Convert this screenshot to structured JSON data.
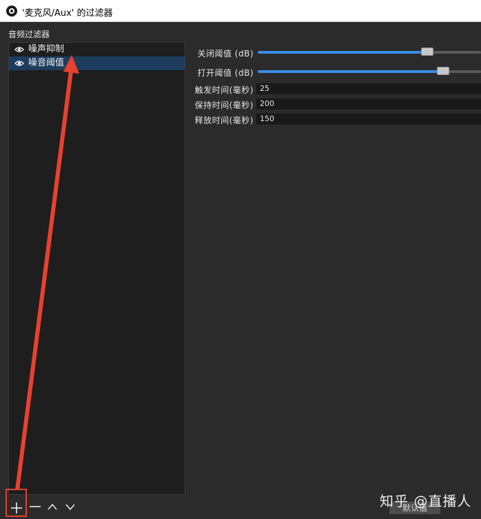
{
  "window": {
    "title": "'麦克风/Aux' 的过滤器",
    "app_icon": "obs-logo-icon"
  },
  "filters": {
    "section_label": "音频过滤器",
    "items": [
      {
        "label": "噪声抑制",
        "icon": "eye-icon",
        "selected": false
      },
      {
        "label": "噪音阈值",
        "icon": "eye-icon",
        "selected": true
      }
    ]
  },
  "properties": {
    "close_threshold": {
      "label": "关闭阈值 (dB)",
      "fill_fraction": 0.76
    },
    "open_threshold": {
      "label": "打开阈值 (dB)",
      "fill_fraction": 0.83
    },
    "attack_time": {
      "label": "触发时间(毫秒)",
      "value": "25"
    },
    "hold_time": {
      "label": "保持时间(毫秒)",
      "value": "200"
    },
    "release_time": {
      "label": "释放时间(毫秒)",
      "value": "150"
    }
  },
  "toolbar": {
    "add_icon": "plus-icon",
    "remove_icon": "minus-icon",
    "move_up_icon": "chevron-up-icon",
    "move_down_icon": "chevron-down-icon"
  },
  "defaults_button": {
    "label": "默认值"
  },
  "watermark": {
    "text": "知乎 @直播人"
  },
  "colors": {
    "background": "#2b2b2b",
    "selection": "#1d3d5e",
    "slider_fill": "#3a8ee6",
    "annotation": "#e8412f"
  }
}
